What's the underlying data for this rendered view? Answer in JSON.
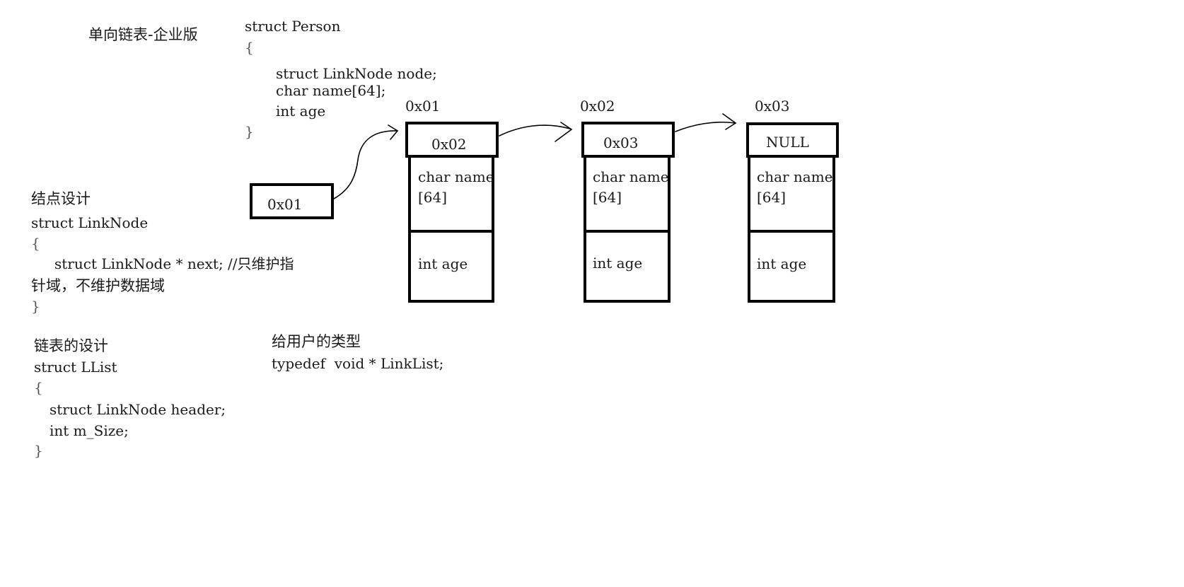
{
  "title": "单向链表-企业版",
  "person_struct": {
    "line1": "struct Person",
    "open": "{",
    "field1": "struct LinkNode node;",
    "field2": "char name[64];",
    "field3": "int age",
    "close": "}"
  },
  "node_design": {
    "heading": "结点设计",
    "line1": "struct LinkNode",
    "open": "{",
    "field1": "struct LinkNode * next; //只维护指",
    "field1_cont": "针域，不维护数据域",
    "close": "}"
  },
  "list_design": {
    "heading": "链表的设计",
    "line1": "struct LList",
    "open": "{",
    "field1": "struct LinkNode header;",
    "field2": "int m_Size;",
    "close": "}"
  },
  "user_type": {
    "heading": "给用户的类型",
    "line1": "typedef  void * LinkList;"
  },
  "head_pointer": {
    "value": "0x01"
  },
  "nodes": [
    {
      "address": "0x01",
      "next": "0x02",
      "name": "char name\n[64]",
      "age": "int age"
    },
    {
      "address": "0x02",
      "next": "0x03",
      "name": "char name\n[64]",
      "age": "int age"
    },
    {
      "address": "0x03",
      "next": "NULL",
      "name": "char name\n[64]",
      "age": "int age"
    }
  ]
}
